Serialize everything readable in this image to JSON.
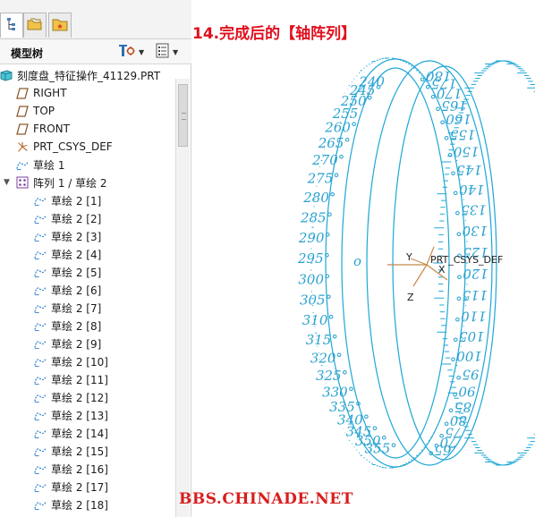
{
  "tabs": [
    {
      "name": "model-tree-tab",
      "icon": "model-tree-icon"
    },
    {
      "name": "folder-browser-tab",
      "icon": "folder-browser-icon"
    },
    {
      "name": "favorites-tab",
      "icon": "favorites-icon"
    }
  ],
  "tree_header": {
    "title": "模型树",
    "settings_icon": "settings-icon",
    "show_icon": "show-icon",
    "dropdown_icon": "chevron-down-icon"
  },
  "tree": [
    {
      "label": "刻度盘_特征操作_41129.PRT",
      "icon": "part-icon",
      "indent": 0
    },
    {
      "label": "RIGHT",
      "icon": "datum-plane-icon",
      "indent": 1
    },
    {
      "label": "TOP",
      "icon": "datum-plane-icon",
      "indent": 1
    },
    {
      "label": "FRONT",
      "icon": "datum-plane-icon",
      "indent": 1
    },
    {
      "label": "PRT_CSYS_DEF",
      "icon": "coordinate-system-icon",
      "indent": 1
    },
    {
      "label": "草绘 1",
      "icon": "sketch-icon",
      "indent": 1
    },
    {
      "label": "阵列 1 / 草绘 2",
      "icon": "pattern-icon",
      "indent": 1,
      "expanded": true
    },
    {
      "label": "草绘 2 [1]",
      "icon": "sketch-icon",
      "indent": 2
    },
    {
      "label": "草绘 2 [2]",
      "icon": "sketch-icon",
      "indent": 2
    },
    {
      "label": "草绘 2 [3]",
      "icon": "sketch-icon",
      "indent": 2
    },
    {
      "label": "草绘 2 [4]",
      "icon": "sketch-icon",
      "indent": 2
    },
    {
      "label": "草绘 2 [5]",
      "icon": "sketch-icon",
      "indent": 2
    },
    {
      "label": "草绘 2 [6]",
      "icon": "sketch-icon",
      "indent": 2
    },
    {
      "label": "草绘 2 [7]",
      "icon": "sketch-icon",
      "indent": 2
    },
    {
      "label": "草绘 2 [8]",
      "icon": "sketch-icon",
      "indent": 2
    },
    {
      "label": "草绘 2 [9]",
      "icon": "sketch-icon",
      "indent": 2
    },
    {
      "label": "草绘 2 [10]",
      "icon": "sketch-icon",
      "indent": 2
    },
    {
      "label": "草绘 2 [11]",
      "icon": "sketch-icon",
      "indent": 2
    },
    {
      "label": "草绘 2 [12]",
      "icon": "sketch-icon",
      "indent": 2
    },
    {
      "label": "草绘 2 [13]",
      "icon": "sketch-icon",
      "indent": 2
    },
    {
      "label": "草绘 2 [14]",
      "icon": "sketch-icon",
      "indent": 2
    },
    {
      "label": "草绘 2 [15]",
      "icon": "sketch-icon",
      "indent": 2
    },
    {
      "label": "草绘 2 [16]",
      "icon": "sketch-icon",
      "indent": 2
    },
    {
      "label": "草绘 2 [17]",
      "icon": "sketch-icon",
      "indent": 2
    },
    {
      "label": "草绘 2 [18]",
      "icon": "sketch-icon",
      "indent": 2
    }
  ],
  "graphics": {
    "step_title": "14.完成后的【轴阵列】",
    "watermark": "BBS.CHINADE.NET",
    "csys_label": "PRT_CSYS_DEF",
    "axis_labels": {
      "x": "X",
      "y": "Y",
      "z": "Z"
    },
    "dial_left_labels": [
      "240",
      "245°",
      "250°",
      "255",
      "260°",
      "265°",
      "270°",
      "275°",
      "280°",
      "285°",
      "290°",
      "295°",
      "300°",
      "305°",
      "310°",
      "315°",
      "320°",
      "325°",
      "330°",
      "335°",
      "340°",
      "345°",
      "350°",
      "355°"
    ],
    "dial_right_labels": [
      "180°",
      "175°",
      "170°",
      "165°",
      "160°",
      "155°",
      "150°",
      "145°",
      "140°",
      "135°",
      "130°",
      "125°",
      "120°",
      "115°",
      "110°",
      "105°",
      "100°",
      "95°",
      "90°",
      "85°",
      "80°",
      "75°",
      "70°",
      "65°"
    ],
    "center_mark": "o",
    "colors": {
      "ring": "#1ea7d6",
      "numbers": "#2aa2cf",
      "title": "#e0101f",
      "watermark": "#d81e1e",
      "csys": "#c8894a"
    }
  }
}
